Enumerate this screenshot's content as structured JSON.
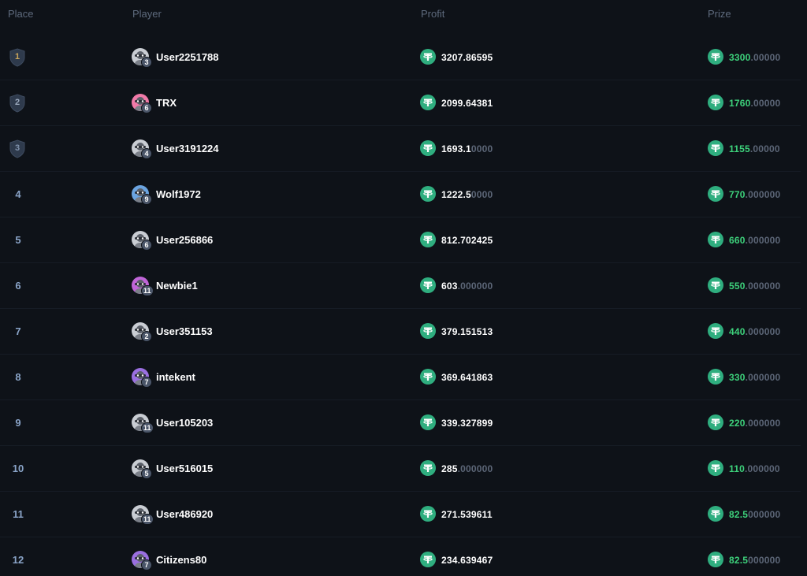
{
  "header": {
    "place": "Place",
    "player": "Player",
    "profit": "Profit",
    "prize": "Prize"
  },
  "colors": {
    "background": "#0e1218",
    "coin": "#2fae7f",
    "prize_green": "#3dd17b",
    "header_text": "#5e6a7d",
    "shield_gold": "#c8a45a",
    "shield_silver": "#9aa8bd",
    "shield_bronze": "#8193ad"
  },
  "icons": {
    "coin": "tether-coin-icon",
    "rank": "shield-icon"
  },
  "rows": [
    {
      "place": "1",
      "shield": true,
      "name": "User2251788",
      "level": "3",
      "avatar": "raccoon",
      "profit_main": "3207.86595",
      "profit_dim": "",
      "prize_main": "3300",
      "prize_dim": ".00000"
    },
    {
      "place": "2",
      "shield": true,
      "name": "TRX",
      "level": "6",
      "avatar": "pink",
      "profit_main": "2099.64381",
      "profit_dim": "",
      "prize_main": "1760",
      "prize_dim": ".00000"
    },
    {
      "place": "3",
      "shield": true,
      "name": "User3191224",
      "level": "4",
      "avatar": "raccoon",
      "profit_main": "1693.1",
      "profit_dim": "0000",
      "prize_main": "1155",
      "prize_dim": ".00000"
    },
    {
      "place": "4",
      "shield": false,
      "name": "Wolf1972",
      "level": "9",
      "avatar": "blue",
      "profit_main": "1222.5",
      "profit_dim": "0000",
      "prize_main": "770",
      "prize_dim": ".000000"
    },
    {
      "place": "5",
      "shield": false,
      "name": "User256866",
      "level": "6",
      "avatar": "raccoon",
      "profit_main": "812.702425",
      "profit_dim": "",
      "prize_main": "660",
      "prize_dim": ".000000"
    },
    {
      "place": "6",
      "shield": false,
      "name": "Newbie1",
      "level": "11",
      "avatar": "purple-hat",
      "profit_main": "603",
      "profit_dim": ".000000",
      "prize_main": "550",
      "prize_dim": ".000000"
    },
    {
      "place": "7",
      "shield": false,
      "name": "User351153",
      "level": "2",
      "avatar": "raccoon",
      "profit_main": "379.151513",
      "profit_dim": "",
      "prize_main": "440",
      "prize_dim": ".000000"
    },
    {
      "place": "8",
      "shield": false,
      "name": "intekent",
      "level": "7",
      "avatar": "violet",
      "profit_main": "369.641863",
      "profit_dim": "",
      "prize_main": "330",
      "prize_dim": ".000000"
    },
    {
      "place": "9",
      "shield": false,
      "name": "User105203",
      "level": "11",
      "avatar": "raccoon",
      "profit_main": "339.327899",
      "profit_dim": "",
      "prize_main": "220",
      "prize_dim": ".000000"
    },
    {
      "place": "10",
      "shield": false,
      "name": "User516015",
      "level": "5",
      "avatar": "raccoon",
      "profit_main": "285",
      "profit_dim": ".000000",
      "prize_main": "110",
      "prize_dim": ".000000"
    },
    {
      "place": "11",
      "shield": false,
      "name": "User486920",
      "level": "11",
      "avatar": "raccoon",
      "profit_main": "271.539611",
      "profit_dim": "",
      "prize_main": "82.5",
      "prize_dim": "000000"
    },
    {
      "place": "12",
      "shield": false,
      "name": "Citizens80",
      "level": "7",
      "avatar": "violet",
      "profit_main": "234.639467",
      "profit_dim": "",
      "prize_main": "82.5",
      "prize_dim": "000000"
    }
  ]
}
